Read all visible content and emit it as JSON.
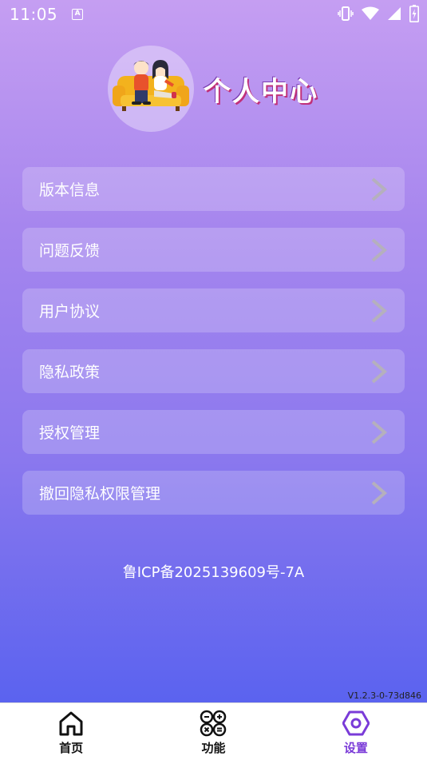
{
  "status_bar": {
    "time": "11:05",
    "notification_icon": "A"
  },
  "header": {
    "title": "个人中心",
    "avatar_icon": "couple-on-sofa-illustration"
  },
  "menu": {
    "items": [
      {
        "label": "版本信息"
      },
      {
        "label": "问题反馈"
      },
      {
        "label": "用户协议"
      },
      {
        "label": "隐私政策"
      },
      {
        "label": "授权管理"
      },
      {
        "label": "撤回隐私权限管理"
      }
    ]
  },
  "footer": {
    "icp": "鲁ICP备2025139609号-7A",
    "version": "V1.2.3-0-73d846"
  },
  "tabbar": {
    "tabs": [
      {
        "label": "首页",
        "icon": "home-icon",
        "active": false
      },
      {
        "label": "功能",
        "icon": "calculator-icon",
        "active": false
      },
      {
        "label": "设置",
        "icon": "hexagon-settings-icon",
        "active": true
      }
    ]
  },
  "colors": {
    "active_tab": "#7a3bd8",
    "gradient_top": "#c59ef2",
    "gradient_bottom": "#5862ee"
  }
}
